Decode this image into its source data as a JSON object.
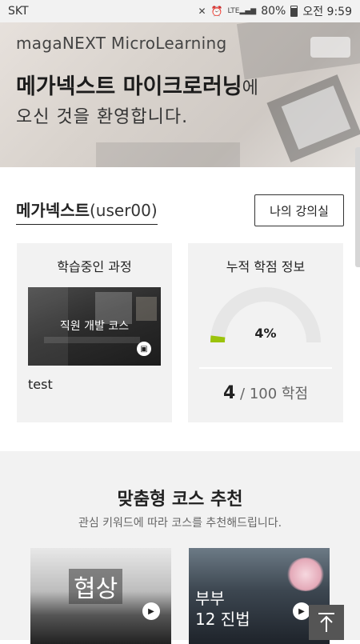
{
  "status_bar": {
    "carrier": "SKT",
    "battery": "80%",
    "time": "오전 9:59",
    "icons": [
      "mute-icon",
      "alarm-icon",
      "lte-signal-icon",
      "battery-icon"
    ]
  },
  "hero": {
    "subtitle": "magaNEXT MicroLearning",
    "title_bold": "메가넥스트 마이크로러닝",
    "title_tail": "에",
    "line2": "오신 것을 환영합니다."
  },
  "user": {
    "name": "메가넥스트",
    "id": "(user00)",
    "my_classroom_button": "나의 강의실"
  },
  "learning_card": {
    "title": "학습중인 과정",
    "thumbnail_label": "직원 개발 코스",
    "course_name": "test"
  },
  "credit_card": {
    "title": "누적 학점 정보",
    "percent": 4,
    "percent_label": "4%",
    "earned": "4",
    "total_label": "/ 100 학점",
    "accent_color": "#9bc30a"
  },
  "recommend": {
    "title": "맞춤형 코스 추천",
    "subtitle": "관심 키워드에 따라 코스를 추천해드립니다.",
    "items": [
      {
        "label": "협상"
      },
      {
        "label_line1": "부부",
        "label_line2": "12 진법"
      }
    ]
  },
  "scroll_top_icon": "arrow-up-icon"
}
